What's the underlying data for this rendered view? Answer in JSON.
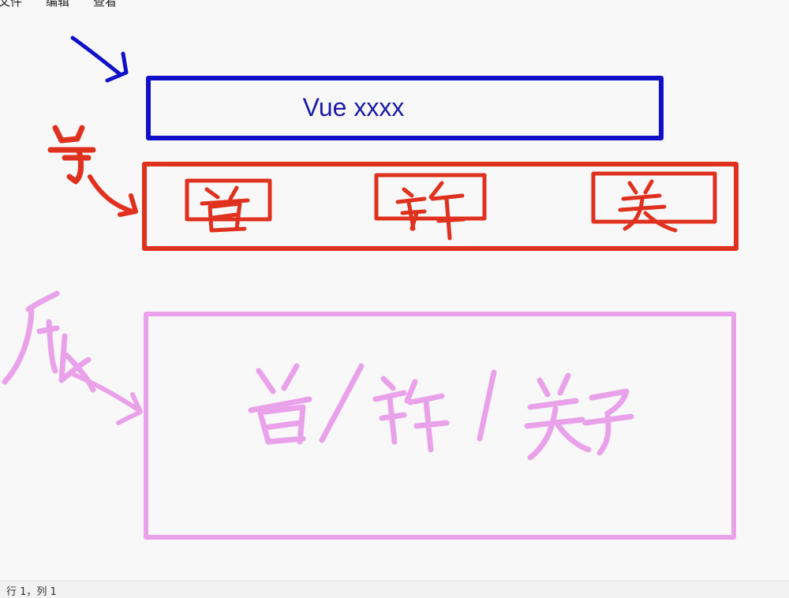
{
  "menu": {
    "file": "文件",
    "edit": "编辑",
    "view": "查看"
  },
  "drawing": {
    "header_box_text": "Vue xxxx",
    "colors": {
      "blue": "#1010c8",
      "red": "#e0301e",
      "pink": "#e9a2ea"
    }
  },
  "status": {
    "position": "行 1，列 1"
  }
}
